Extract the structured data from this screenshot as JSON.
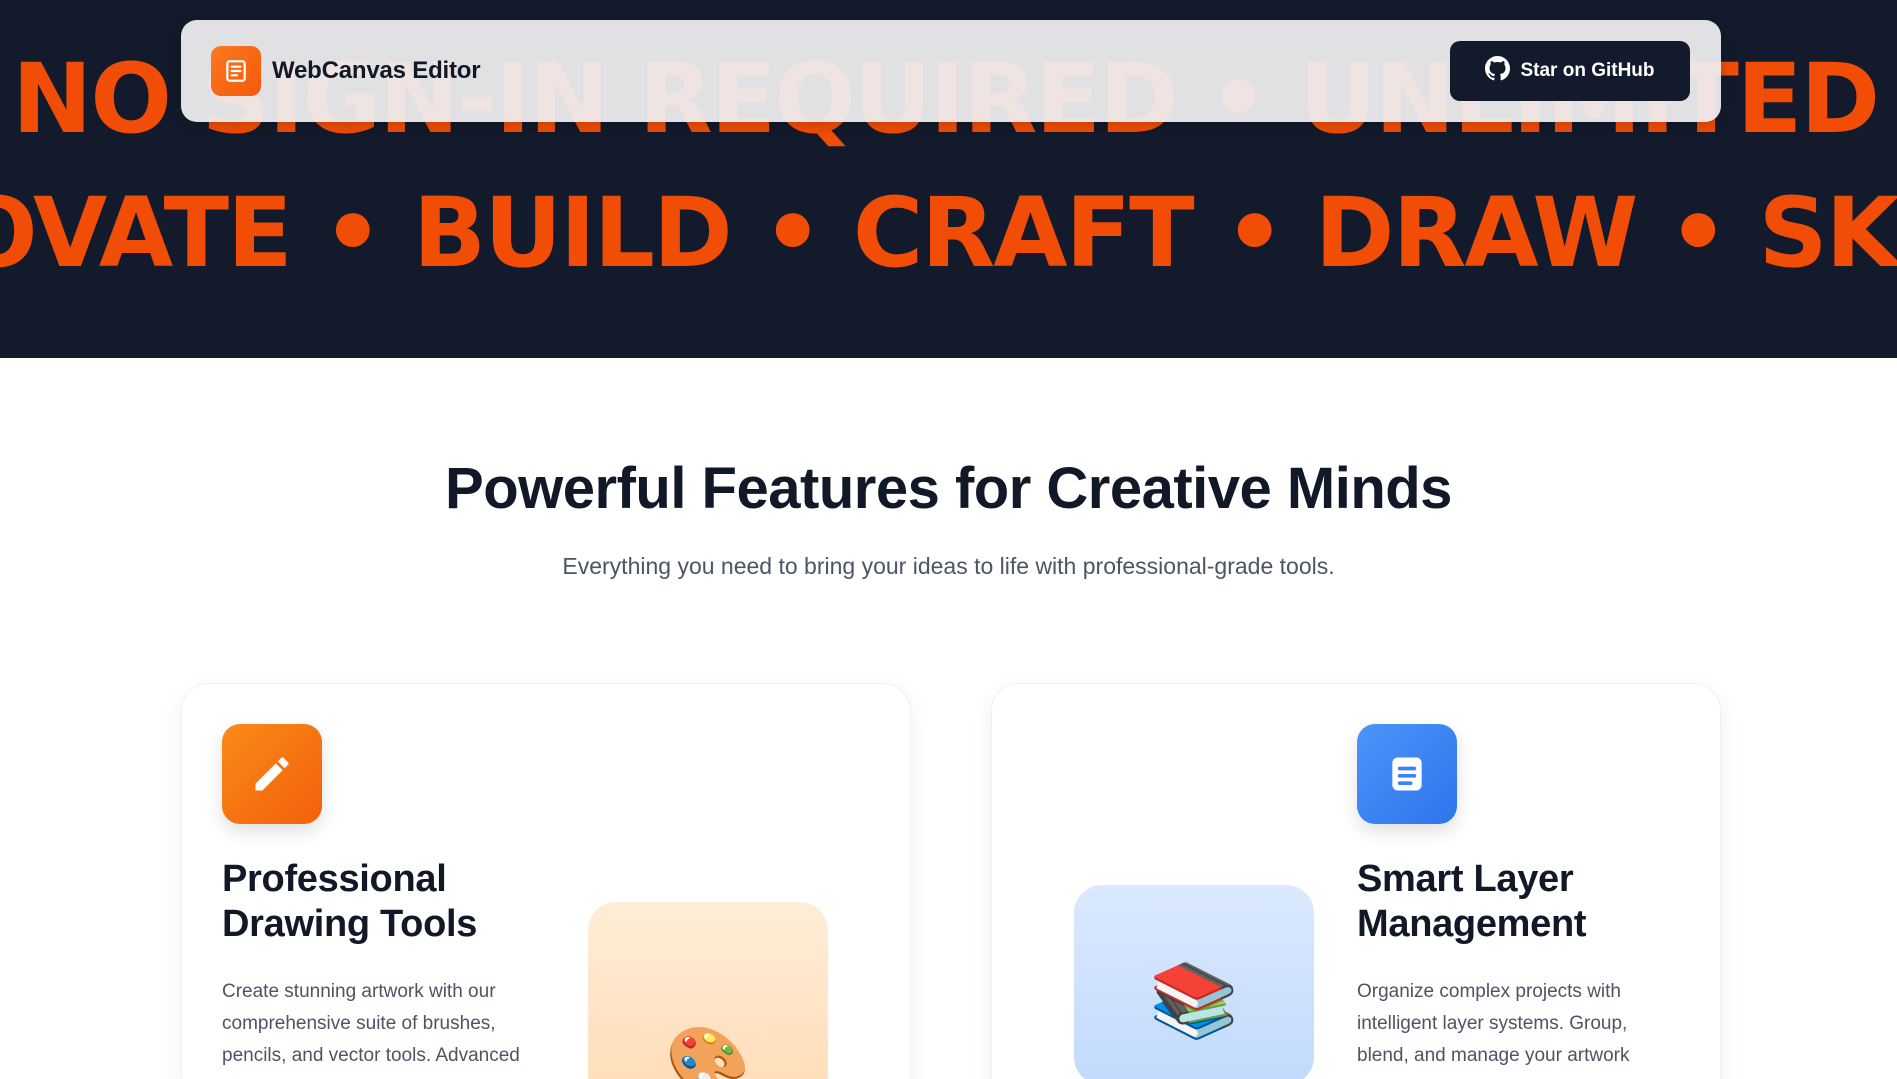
{
  "hero": {
    "marquee_line_1": "NO SIGN-IN REQUIRED • UNLIMITED CREATIVITY",
    "marquee_line_2": "OVATE • BUILD • CRAFT • DRAW • SKETCH •",
    "background_color": "#131a2b",
    "accent_color": "#f24d06"
  },
  "navbar": {
    "brand_name": "WebCanvas Editor",
    "brand_icon": "document-icon",
    "github_label": "Star on GitHub",
    "github_icon": "github-icon"
  },
  "features": {
    "title": "Powerful Features for Creative Minds",
    "subtitle": "Everything you need to bring your ideas to life with professional-grade tools.",
    "cards": [
      {
        "icon": "pencil-icon",
        "icon_color": "#f46a0f",
        "title_line_1": "Professional",
        "title_line_2": "Drawing Tools",
        "text_line_1": "Create stunning artwork with our",
        "text_line_2": "comprehensive suite of brushes,",
        "text_line_3": "pencils, and vector tools. Advanced",
        "visual": "palette-emoji",
        "visual_glyph": "🎨"
      },
      {
        "icon": "document-icon",
        "icon_color": "#3b82f6",
        "title_line_1": "Smart Layer",
        "title_line_2": "Management",
        "text_line_1": "Organize complex projects with",
        "text_line_2": "intelligent layer systems. Group,",
        "text_line_3": "blend, and manage your artwork",
        "visual": "books-emoji",
        "visual_glyph": "📚"
      }
    ]
  }
}
